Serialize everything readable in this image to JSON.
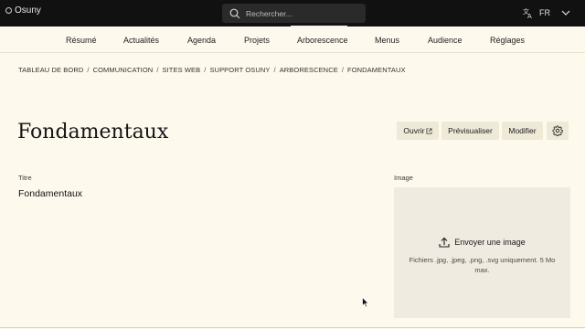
{
  "topbar": {
    "brand": "Osuny",
    "search_placeholder": "Rechercher...",
    "language": "FR"
  },
  "nav": {
    "items": [
      "Résumé",
      "Actualités",
      "Agenda",
      "Projets",
      "Arborescence",
      "Menus",
      "Audience",
      "Réglages"
    ],
    "active": "Arborescence"
  },
  "breadcrumb": [
    "TABLEAU DE BORD",
    "COMMUNICATION",
    "SITES WEB",
    "SUPPORT OSUNY",
    "ARBORESCENCE",
    "FONDAMENTAUX"
  ],
  "page": {
    "title": "Fondamentaux"
  },
  "actions": {
    "open": "Ouvrir",
    "preview": "Prévisualiser",
    "edit": "Modifier"
  },
  "fields": {
    "title_label": "Titre",
    "title_value": "Fondamentaux",
    "image_label": "Image",
    "upload_label": "Envoyer une image",
    "upload_hint": "Fichiers .jpg, .jpeg, .png, .svg uniquement. 5 Mo max."
  },
  "icons": {
    "brand": "osuny-logo-icon",
    "search": "search-icon",
    "language": "translate-icon",
    "chevron": "chevron-down-icon",
    "external": "external-link-icon",
    "settings": "gear-icon",
    "upload": "upload-icon"
  }
}
